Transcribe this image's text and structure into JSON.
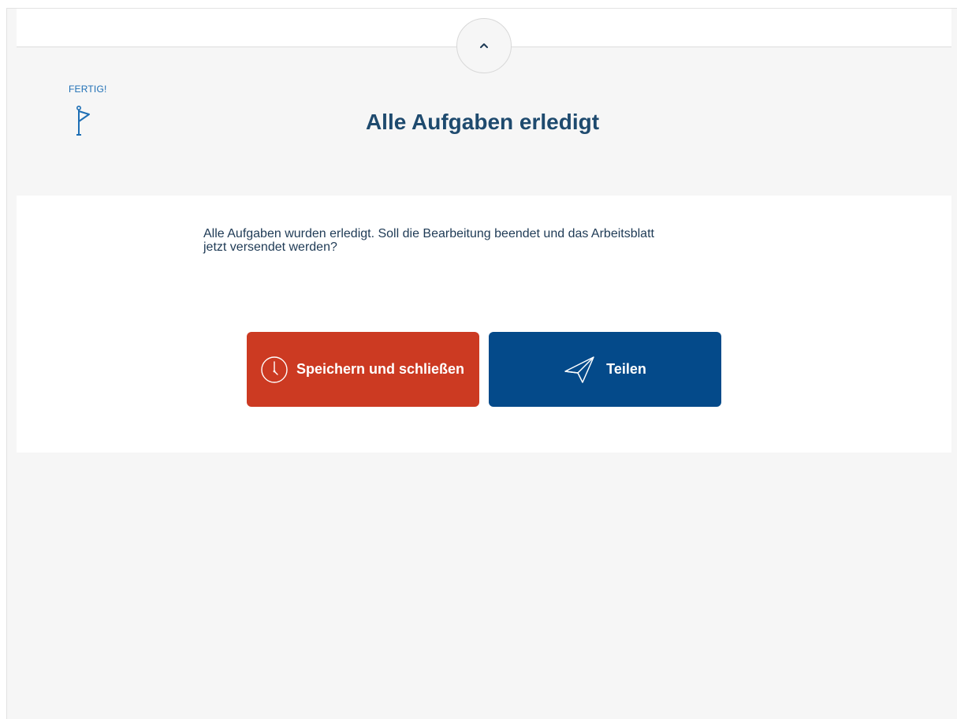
{
  "header": {
    "collapse_icon": "chevron-up-icon"
  },
  "status": {
    "label": "FERTIG!",
    "icon": "flag-icon"
  },
  "title": "Alle Aufgaben erledigt",
  "card": {
    "message_line1": "Alle Aufgaben wurden erledigt. Soll die Bearbeitung beendet und das Arbeitsblatt",
    "message_line2": "jetzt versendet werden?"
  },
  "buttons": {
    "save_label": "Speichern und schließen",
    "save_icon": "clock-icon",
    "share_label": "Teilen",
    "share_icon": "paper-plane-icon"
  },
  "colors": {
    "save_button": "#cc3a22",
    "share_button": "#044a8a",
    "title": "#1e4a6e",
    "accent": "#1e6fb5",
    "background": "#f6f6f6"
  }
}
